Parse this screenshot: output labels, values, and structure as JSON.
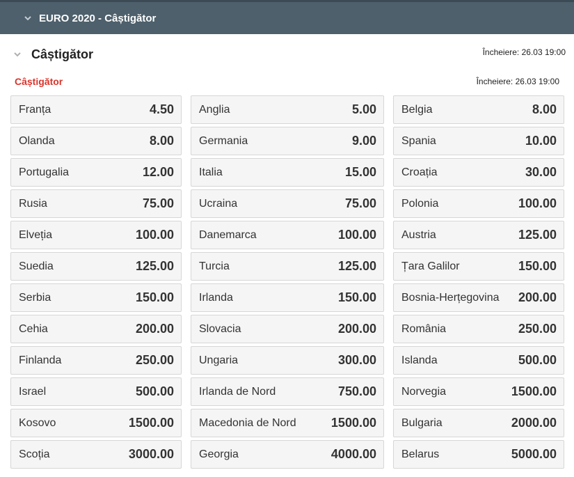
{
  "header": {
    "title": "EURO 2020 - Câștigător",
    "chevron_icon": "chevron-down-icon"
  },
  "market": {
    "title": "Câștigător",
    "closing": "Încheiere: 26.03 19:00",
    "chevron_icon": "chevron-down-icon"
  },
  "submarket": {
    "title": "Câștigător",
    "closing": "Încheiere: 26.03 19:00"
  },
  "colors": {
    "header_bg": "#4d606c",
    "accent_red": "#d9342b",
    "cell_bg": "#f5f5f5"
  },
  "outcomes": [
    {
      "name": "Franța",
      "odd": "4.50"
    },
    {
      "name": "Anglia",
      "odd": "5.00"
    },
    {
      "name": "Belgia",
      "odd": "8.00"
    },
    {
      "name": "Olanda",
      "odd": "8.00"
    },
    {
      "name": "Germania",
      "odd": "9.00"
    },
    {
      "name": "Spania",
      "odd": "10.00"
    },
    {
      "name": "Portugalia",
      "odd": "12.00"
    },
    {
      "name": "Italia",
      "odd": "15.00"
    },
    {
      "name": "Croația",
      "odd": "30.00"
    },
    {
      "name": "Rusia",
      "odd": "75.00"
    },
    {
      "name": "Ucraina",
      "odd": "75.00"
    },
    {
      "name": "Polonia",
      "odd": "100.00"
    },
    {
      "name": "Elveția",
      "odd": "100.00"
    },
    {
      "name": "Danemarca",
      "odd": "100.00"
    },
    {
      "name": "Austria",
      "odd": "125.00"
    },
    {
      "name": "Suedia",
      "odd": "125.00"
    },
    {
      "name": "Turcia",
      "odd": "125.00"
    },
    {
      "name": "Țara Galilor",
      "odd": "150.00"
    },
    {
      "name": "Serbia",
      "odd": "150.00"
    },
    {
      "name": "Irlanda",
      "odd": "150.00"
    },
    {
      "name": "Bosnia-Herțegovina",
      "odd": "200.00"
    },
    {
      "name": "Cehia",
      "odd": "200.00"
    },
    {
      "name": "Slovacia",
      "odd": "200.00"
    },
    {
      "name": "România",
      "odd": "250.00"
    },
    {
      "name": "Finlanda",
      "odd": "250.00"
    },
    {
      "name": "Ungaria",
      "odd": "300.00"
    },
    {
      "name": "Islanda",
      "odd": "500.00"
    },
    {
      "name": "Israel",
      "odd": "500.00"
    },
    {
      "name": "Irlanda de Nord",
      "odd": "750.00"
    },
    {
      "name": "Norvegia",
      "odd": "1500.00"
    },
    {
      "name": "Kosovo",
      "odd": "1500.00"
    },
    {
      "name": "Macedonia de Nord",
      "odd": "1500.00"
    },
    {
      "name": "Bulgaria",
      "odd": "2000.00"
    },
    {
      "name": "Scoția",
      "odd": "3000.00"
    },
    {
      "name": "Georgia",
      "odd": "4000.00"
    },
    {
      "name": "Belarus",
      "odd": "5000.00"
    }
  ]
}
